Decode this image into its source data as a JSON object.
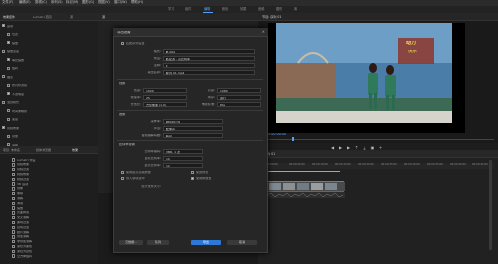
{
  "menubar": [
    "文件(F)",
    "编辑(E)",
    "剪辑(C)",
    "序列(S)",
    "标记(M)",
    "图形(G)",
    "视图(V)",
    "窗口(W)",
    "帮助(H)"
  ],
  "workspaces": [
    "学习",
    "组件",
    "编辑",
    "颜色",
    "效果",
    "音频",
    "图形",
    "库"
  ],
  "active_workspace": "编辑",
  "left_panel": {
    "tabs": [
      "效果控件",
      "Lumetri 范围",
      "源"
    ],
    "rows": [
      {
        "label": "运动",
        "checked": true,
        "value": ""
      },
      {
        "label": "位置",
        "checked": false,
        "value": ""
      },
      {
        "label": "缩放",
        "checked": true,
        "value": ""
      },
      {
        "label": "缩放宽度",
        "checked": false,
        "value": ""
      },
      {
        "label": "等比缩放",
        "checked": true,
        "value": ""
      },
      {
        "label": "旋转",
        "checked": false,
        "value": ""
      },
      {
        "label": "锚点",
        "checked": false,
        "value": ""
      },
      {
        "label": "防闪烁滤镜",
        "checked": false,
        "value": ""
      },
      {
        "label": "不透明度",
        "checked": true,
        "value": ""
      },
      {
        "label": "混合模式",
        "checked": false,
        "value": ""
      },
      {
        "label": "时间重映射",
        "checked": false,
        "value": ""
      },
      {
        "label": "速度",
        "checked": false,
        "value": ""
      },
      {
        "label": "音频效果",
        "checked": true,
        "value": ""
      },
      {
        "label": "音量",
        "checked": false,
        "value": ""
      },
      {
        "label": "旁路",
        "checked": false,
        "value": ""
      },
      {
        "label": "级别",
        "checked": false,
        "value": ""
      },
      {
        "label": "声道音量",
        "checked": false,
        "value": ""
      },
      {
        "label": "声像器",
        "checked": false,
        "value": ""
      }
    ]
  },
  "dialog": {
    "title": "导出设置",
    "basic": [
      {
        "label": "匹配序列设置",
        "value": ""
      },
      {
        "label": "格式:",
        "value": "H.264"
      },
      {
        "label": "预设:",
        "value": "匹配源 - 高比特率"
      },
      {
        "label": "注释:",
        "value": ""
      },
      {
        "label": "输出名称:",
        "value": "序列 01.mp4"
      }
    ],
    "video_section": "视频",
    "video_fields": [
      {
        "label": "宽度:",
        "value": "1920"
      },
      {
        "label": "高度:",
        "value": "1080"
      },
      {
        "label": "帧速率:",
        "value": "25"
      },
      {
        "label": "场序:",
        "value": "逐行"
      },
      {
        "label": "长宽比:",
        "value": "方形像素 (1.0)"
      },
      {
        "label": "电视标准:",
        "value": "PAL"
      }
    ],
    "audio_section": "音频",
    "audio_fields": [
      {
        "label": "采样率:",
        "value": "48000 Hz"
      },
      {
        "label": "声道:",
        "value": "立体声"
      },
      {
        "label": "音频编解码器:",
        "value": "AAC"
      }
    ],
    "bitrate_section": "比特率设置",
    "bitrate_fields": [
      {
        "label": "比特率编码:",
        "value": "VBR, 1 次"
      },
      {
        "label": "目标比特率:",
        "value": "10"
      },
      {
        "label": "最大比特率:",
        "value": "12"
      }
    ],
    "options": [
      {
        "label": "使用最高渲染质量",
        "checked": false
      },
      {
        "label": "使用预览",
        "checked": false
      },
      {
        "label": "导入到项目中",
        "checked": false
      },
      {
        "label": "使用帧混合",
        "checked": true
      }
    ],
    "estimated_size_label": "估计文件大小:",
    "estimated_size": "",
    "metadata_button": "元数据...",
    "queue_button": "队列",
    "export_button": "导出",
    "cancel_button": "取消"
  },
  "program": {
    "title": "节目: 序列 01",
    "timecode": "00:00:00:00",
    "overlay_text": [
      "动力",
      "快乐"
    ]
  },
  "timeline": {
    "title": "序列 01",
    "ruler": [
      "00:00:00",
      "00:00:05:00",
      "00:00:10:00",
      "00:00:15:00",
      "00:00:20:00",
      "00:00:25:00",
      "00:00:30:00",
      "00:00:35:00",
      "00:00:40:00",
      "00:00:45:00"
    ]
  },
  "project_panel": {
    "tabs": [
      "项目: 未命名",
      "媒体浏览器",
      "效果"
    ],
    "items": [
      "Lumetri 预设",
      "音频效果",
      "音频过渡",
      "视频效果",
      "视频过渡",
      "3D 运动",
      "划像",
      "擦除",
      "溶解",
      "滑动",
      "缩放",
      "页面剥落",
      "交叉溶解",
      "黑场过渡",
      "白场过渡",
      "胶片溶解",
      "叠加溶解",
      "非叠加溶解",
      "渐隐为黑色",
      "渐隐为白色",
      "立方体旋转"
    ]
  }
}
